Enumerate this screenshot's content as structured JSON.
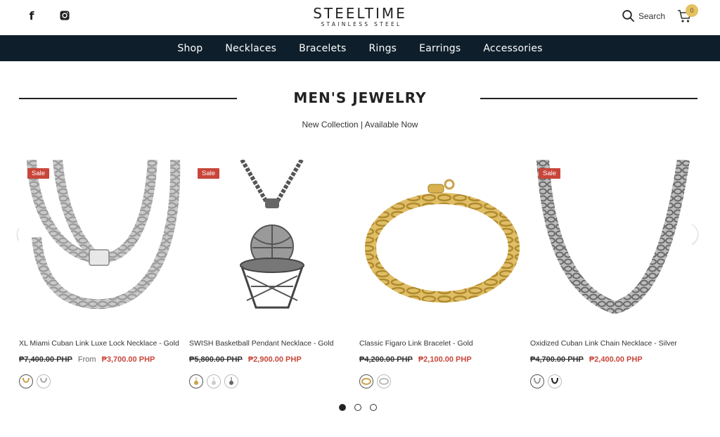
{
  "header": {
    "logo_main": "STEELTIME",
    "logo_sub": "STAINLESS STEEL",
    "search_label": "Search",
    "cart_count": "0",
    "social": [
      "facebook-icon",
      "instagram-icon"
    ]
  },
  "nav": {
    "items": [
      "Shop",
      "Necklaces",
      "Bracelets",
      "Rings",
      "Earrings",
      "Accessories"
    ]
  },
  "section": {
    "title": "MEN'S JEWELRY",
    "subtitle": "New Collection | Available Now"
  },
  "products": [
    {
      "badge": "Sale",
      "name": "XL Miami Cuban Link Luxe Lock Necklace - Gold",
      "old_price": "₱7,400.00 PHP",
      "from_label": "From",
      "new_price": "₱3,700.00 PHP",
      "swatches": [
        "gold",
        "silver"
      ]
    },
    {
      "badge": "Sale",
      "name": "SWISH Basketball Pendant Necklace - Gold",
      "old_price": "₱5,800.00 PHP",
      "from_label": "",
      "new_price": "₱2,900.00 PHP",
      "swatches": [
        "gold",
        "silver",
        "gunmetal"
      ]
    },
    {
      "badge": "",
      "name": "Classic Figaro Link Bracelet - Gold",
      "old_price": "₱4,200.00 PHP",
      "from_label": "",
      "new_price": "₱2,100.00 PHP",
      "swatches": [
        "gold",
        "silver"
      ]
    },
    {
      "badge": "Sale",
      "name": "Oxidized Cuban Link Chain Necklace - Silver",
      "old_price": "₱4,700.00 PHP",
      "from_label": "",
      "new_price": "₱2,400.00 PHP",
      "swatches": [
        "silver",
        "black"
      ]
    }
  ],
  "carousel": {
    "pages": 3,
    "active": 1
  },
  "colors": {
    "nav_bg": "#0e1f2b",
    "sale": "#c8463a",
    "badge": "#e5c261"
  }
}
